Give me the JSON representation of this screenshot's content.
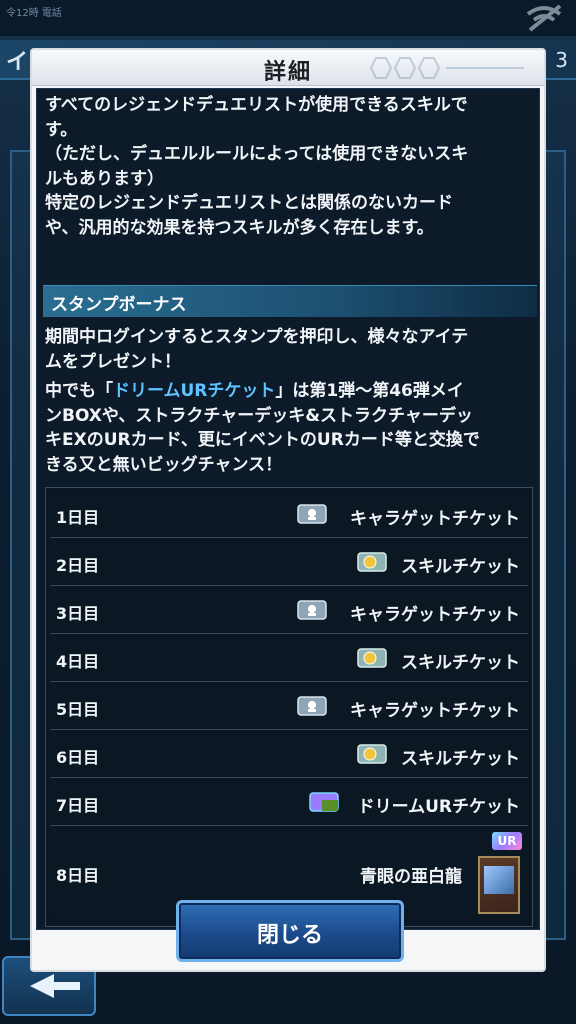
{
  "background": {
    "status_text": "令12時 電話",
    "header_title": "イン",
    "header_number": "3"
  },
  "modal": {
    "title": "詳細",
    "intro_lines": [
      "すべてのレジェンドデュエリストが使用できるスキルで",
      "す。",
      "（ただし、デュエルルールによっては使用できないスキ",
      "ルもあります）",
      "特定のレジェンドデュエリストとは関係のないカード",
      "や、汎用的な効果を持つスキルが多く存在します。"
    ],
    "section_title": "スタンプボーナス",
    "stamp_intro_lines": [
      "期間中ログインするとスタンプを押印し、様々なアイテ",
      "ムをプレゼント！"
    ],
    "highlight_prefix": "中でも「",
    "highlight_term": "ドリームURチケット",
    "highlight_suffix_lines": [
      "」は第1弾〜第46弾メイ",
      "ンBOXや、ストラクチャーデッキ&ストラクチャーデッ",
      "キEXのURカード、更にイベントのURカード等と交換で",
      "きる又と無いビッグチャンス！"
    ],
    "stamp_rows": [
      {
        "day": "1日目",
        "reward": "キャラゲットチケット",
        "icon": "chara-ticket-icon"
      },
      {
        "day": "2日目",
        "reward": "スキルチケット",
        "icon": "skill-ticket-icon"
      },
      {
        "day": "3日目",
        "reward": "キャラゲットチケット",
        "icon": "chara-ticket-icon"
      },
      {
        "day": "4日目",
        "reward": "スキルチケット",
        "icon": "skill-ticket-icon"
      },
      {
        "day": "5日目",
        "reward": "キャラゲットチケット",
        "icon": "chara-ticket-icon"
      },
      {
        "day": "6日目",
        "reward": "スキルチケット",
        "icon": "skill-ticket-icon"
      },
      {
        "day": "7日目",
        "reward": "ドリームURチケット",
        "icon": "dream-ur-ticket-icon"
      },
      {
        "day": "8日目",
        "reward": "青眼の亜白龍",
        "icon": "card-thumbnail",
        "badge": "UR"
      }
    ],
    "close_button": "閉じる"
  },
  "colors": {
    "highlight": "#5fc3ff",
    "content_bg": "#0c1a2a",
    "section_header": "#2a6e92",
    "button_blue": "#1b4b8c"
  }
}
